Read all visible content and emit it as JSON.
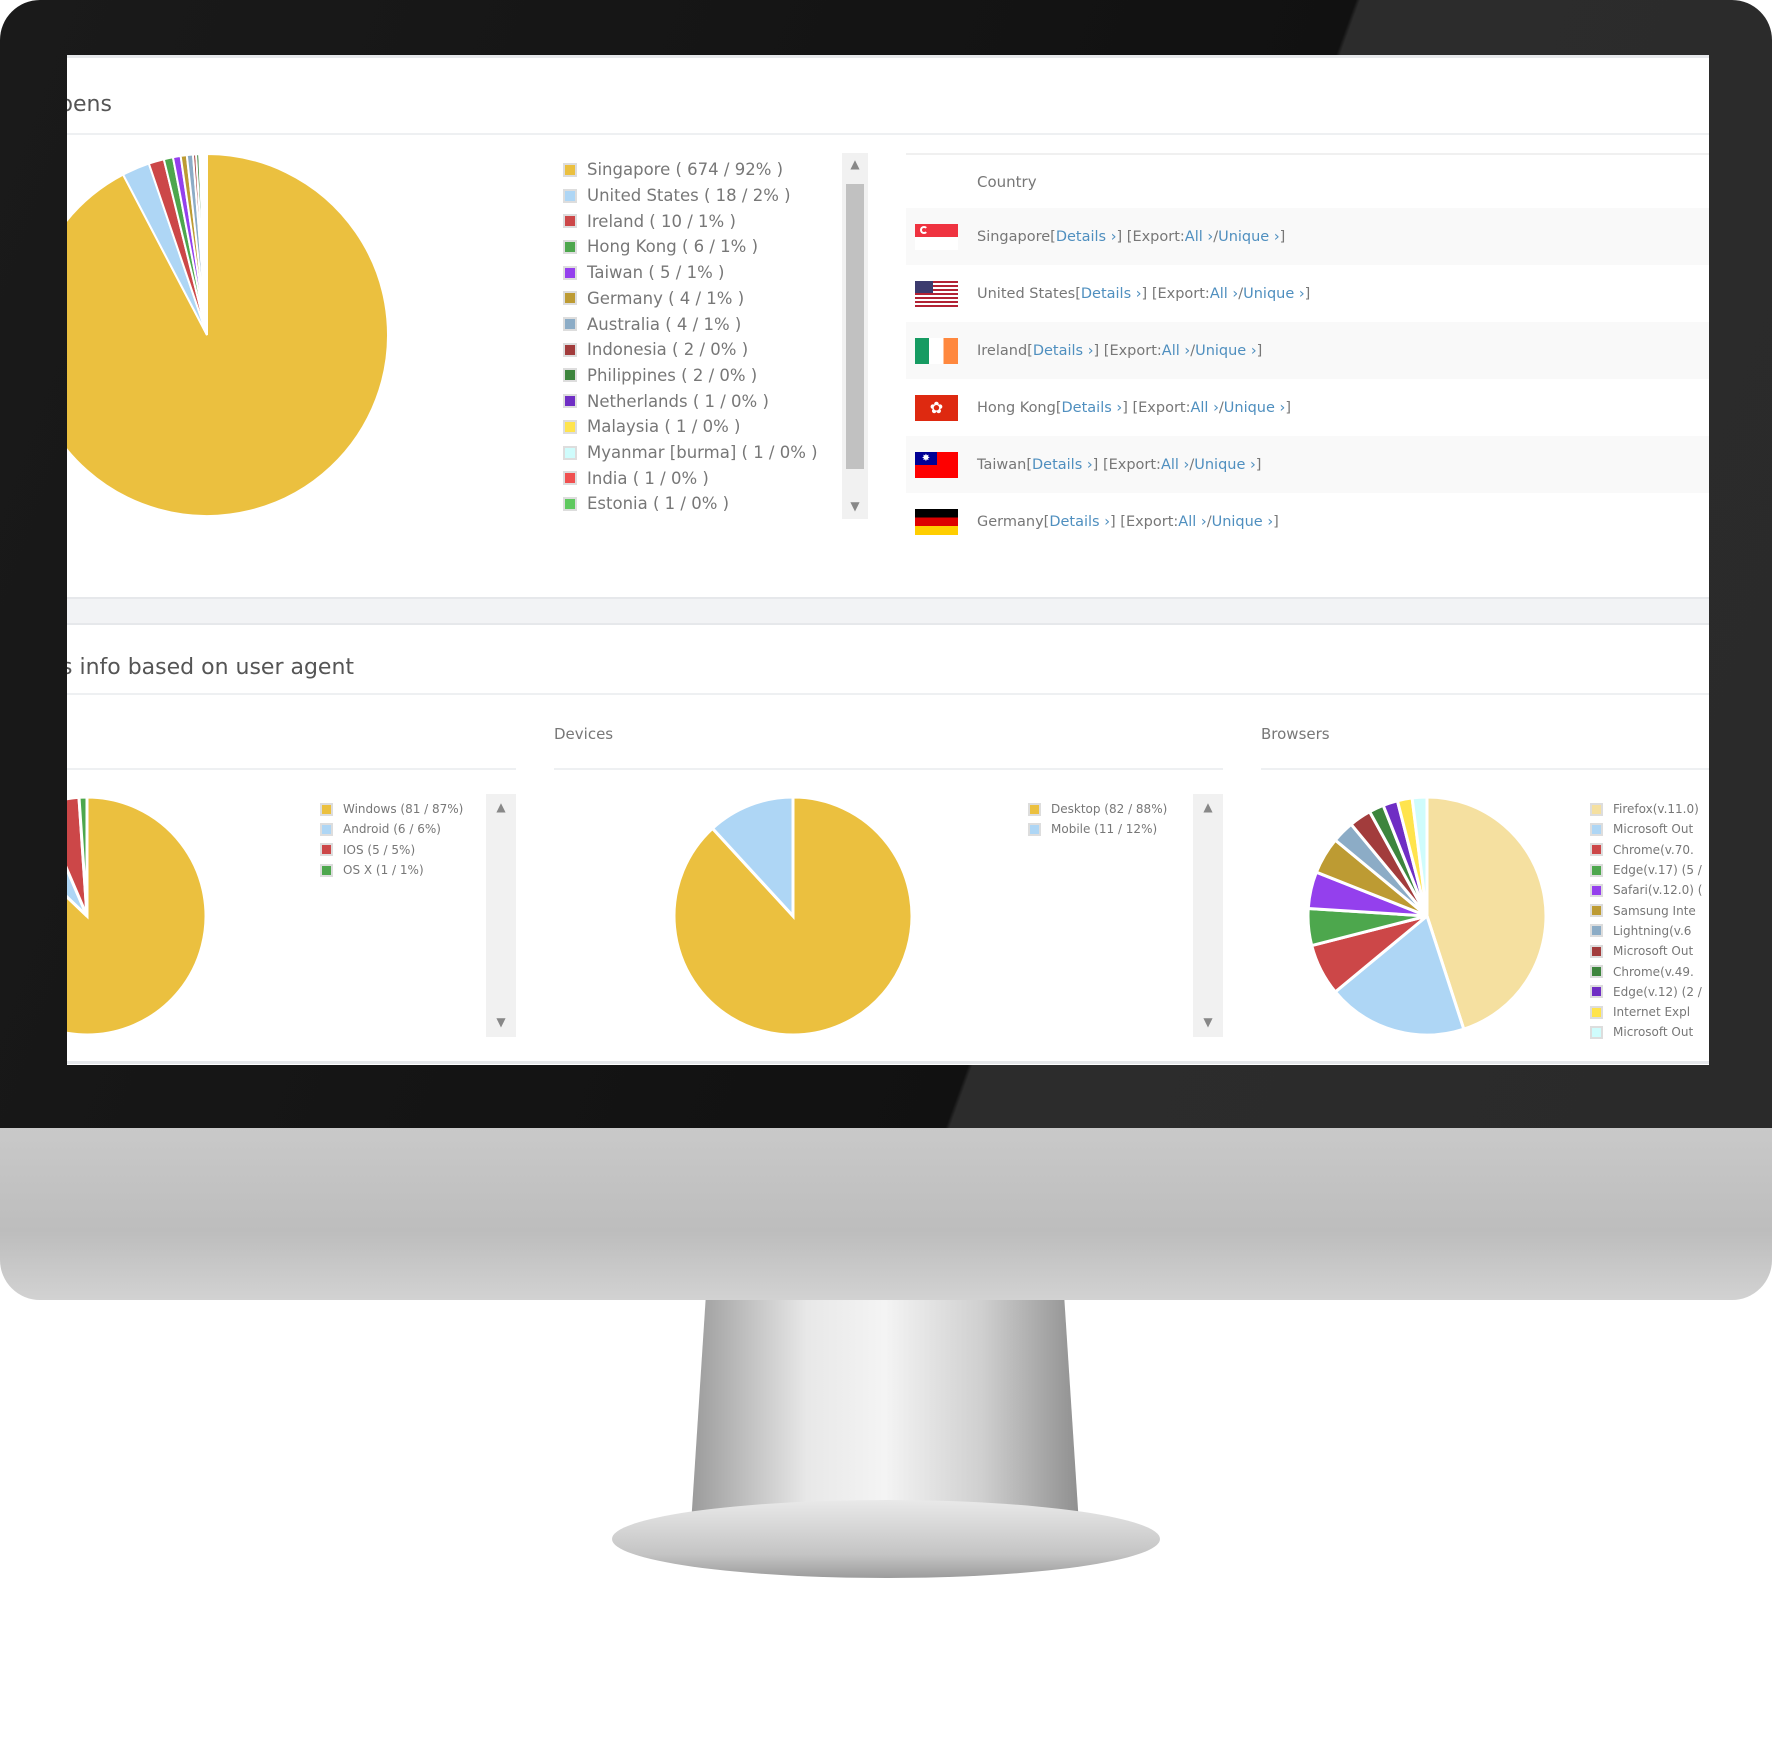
{
  "opens_section": {
    "title": "pens",
    "table_header": "Country",
    "rows": [
      {
        "country": "Singapore",
        "flag": "singapore-flag"
      },
      {
        "country": "United States",
        "flag": "us-flag"
      },
      {
        "country": "Ireland",
        "flag": "ireland-flag"
      },
      {
        "country": "Hong Kong",
        "flag": "hong-kong-flag"
      },
      {
        "country": "Taiwan",
        "flag": "taiwan-flag"
      },
      {
        "country": "Germany",
        "flag": "germany-flag"
      }
    ],
    "link_parts": {
      "open1": " [",
      "details": "Details ›",
      "mid": "] [Export: ",
      "all": "All ›",
      "slash": " / ",
      "unique": "Unique ›",
      "close": "]"
    }
  },
  "agent_section": {
    "title": "s info based on user agent",
    "devices_heading": "Devices",
    "browsers_heading": "Browsers"
  },
  "chart_data": [
    {
      "type": "pie",
      "title": "",
      "categories": [
        "Singapore ( 674 / 92% )",
        "United States ( 18 / 2% )",
        "Ireland ( 10 / 1% )",
        "Hong Kong ( 6 / 1% )",
        "Taiwan ( 5 / 1% )",
        "Germany ( 4 / 1% )",
        "Australia ( 4 / 1% )",
        "Indonesia ( 2 / 0% )",
        "Philippines ( 2 / 0% )",
        "Netherlands ( 1 / 0% )",
        "Malaysia ( 1 / 0% )",
        "Myanmar [burma] ( 1 / 0% )",
        "India ( 1 / 0% )",
        "Estonia ( 1 / 0% )"
      ],
      "values": [
        674,
        18,
        10,
        6,
        5,
        4,
        4,
        2,
        2,
        1,
        1,
        1,
        1,
        1
      ],
      "colors": [
        "#ebc03f",
        "#aed6f5",
        "#cc4748",
        "#4da74d",
        "#9440ed",
        "#bd9b33",
        "#8cacc6",
        "#a23c3c",
        "#3d853d",
        "#6f2ec4",
        "#ffe44d",
        "#cffcfc",
        "#f05050",
        "#5fc95f"
      ],
      "legend": "right"
    },
    {
      "type": "pie",
      "title": "",
      "categories": [
        "Windows (81 / 87%)",
        "Android (6 / 6%)",
        "IOS (5 / 5%)",
        "OS X (1 / 1%)"
      ],
      "values": [
        81,
        6,
        5,
        1
      ],
      "colors": [
        "#ebc03f",
        "#aed6f5",
        "#cc4748",
        "#4da74d"
      ],
      "legend": "right"
    },
    {
      "type": "pie",
      "title": "Devices",
      "categories": [
        "Desktop (82 / 88%)",
        "Mobile (11 / 12%)"
      ],
      "values": [
        82,
        11
      ],
      "colors": [
        "#ebc03f",
        "#aed6f5"
      ],
      "legend": "right"
    },
    {
      "type": "pie",
      "title": "Browsers",
      "categories": [
        "Firefox(v.11.0)",
        "Microsoft Out",
        "Chrome(v.70.",
        "Edge(v.17) (5 /",
        "Safari(v.12.0) (",
        "Samsung Inte",
        "Lightning(v.6",
        "Microsoft Out",
        "Chrome(v.49.",
        "Edge(v.12) (2 /",
        "Internet Expl",
        "Microsoft Out"
      ],
      "values": [
        45,
        19,
        7,
        5,
        5,
        5,
        3,
        3,
        2,
        2,
        2,
        2
      ],
      "colors": [
        "#f5e0a0",
        "#aed6f5",
        "#cc4748",
        "#4da74d",
        "#9440ed",
        "#bd9b33",
        "#8cacc6",
        "#a23c3c",
        "#3d853d",
        "#6f2ec4",
        "#ffe44d",
        "#cffcfc"
      ],
      "legend": "right"
    }
  ]
}
